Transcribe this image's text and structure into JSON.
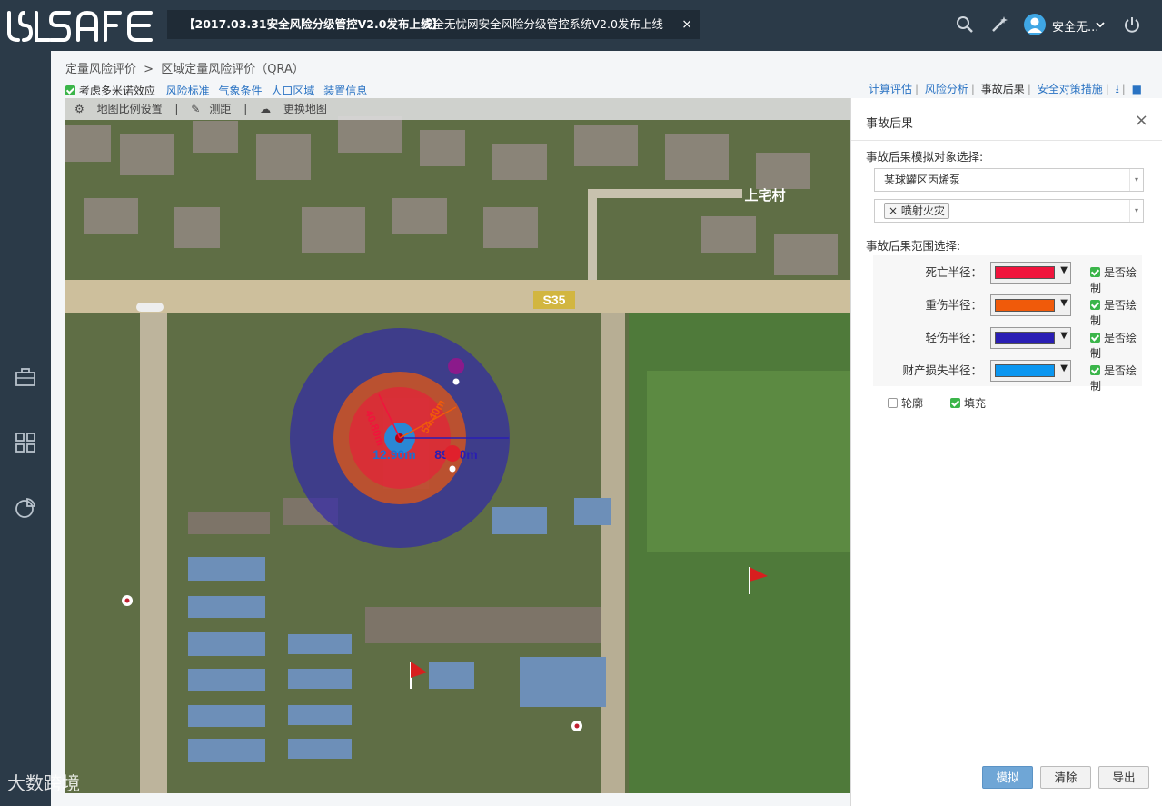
{
  "header": {
    "logo_text": "SSAFE",
    "notice_title": "【2017.03.31安全风险分级管控V2.0发布上线】",
    "notice_text": "安全无忧网安全风险分级管控系统V2.0发布上线",
    "notice_close": "×",
    "user_name": "安全无..."
  },
  "breadcrumb": {
    "root": "定量风险评价",
    "sep": ">",
    "current": "区域定量风险评价（QRA）"
  },
  "options": {
    "domino_label": "考虑多米诺效应",
    "links": [
      "风险标准",
      "气象条件",
      "人口区域",
      "装置信息"
    ]
  },
  "tabs": {
    "items": [
      "计算评估",
      "风险分析",
      "事故后果",
      "安全对策措施"
    ],
    "active": "事故后果"
  },
  "map_tools": {
    "scale": "地图比例设置",
    "measure": "测距",
    "switch_map": "更换地图"
  },
  "map": {
    "road_label": "S35",
    "village_label": "上宅村",
    "radius_small": "12.90m",
    "radius_large": "89.40m",
    "radius_a": "40.80m",
    "radius_b": "54.40m"
  },
  "panel": {
    "title": "事故后果",
    "close": "×",
    "target_label": "事故后果模拟对象选择:",
    "target_value": "某球罐区丙烯泵",
    "scenario_tag": "喷射火灾",
    "range_label": "事故后果范围选择:",
    "rows": [
      {
        "label": "死亡半径：",
        "color": "#f0143c",
        "draw": "是否绘制"
      },
      {
        "label": "重伤半径：",
        "color": "#f05a0a",
        "draw": "是否绘制"
      },
      {
        "label": "轻伤半径：",
        "color": "#2a1eb4",
        "draw": "是否绘制"
      },
      {
        "label": "财产损失半径：",
        "color": "#0a96f0",
        "draw": "是否绘制"
      }
    ],
    "outline_label": "轮廓",
    "fill_label": "填充",
    "buttons": {
      "simulate": "模拟",
      "clear": "清除",
      "export": "导出"
    }
  },
  "watermark": "大数跨境",
  "colors": {
    "topbar": "#2b3a48",
    "accent": "#2a73c3",
    "check": "#3bb54a"
  }
}
